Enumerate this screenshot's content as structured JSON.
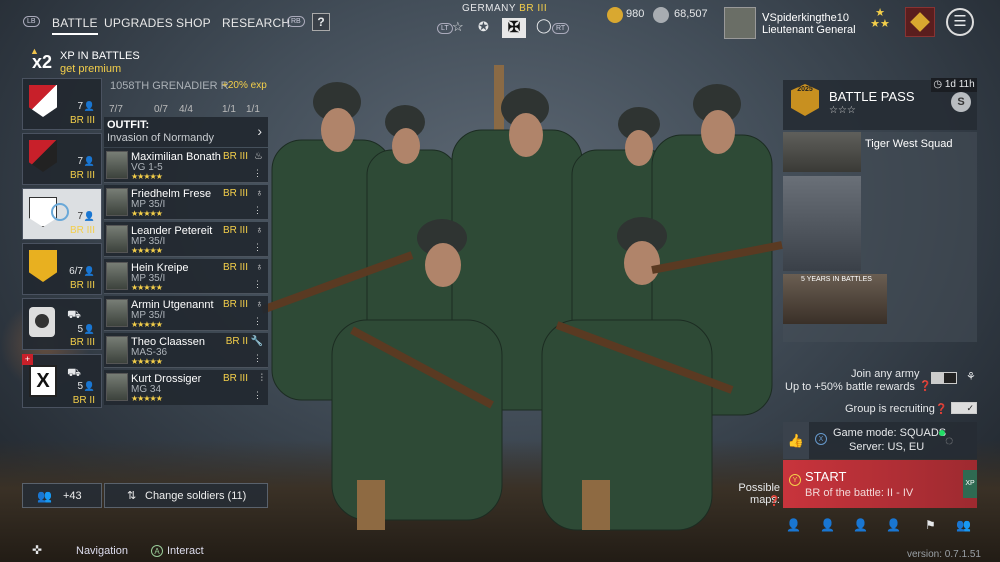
{
  "nav": {
    "lb": "LB",
    "rb": "RB",
    "tabs": [
      "BATTLE",
      "UPGRADES",
      "SHOP",
      "RESEARCH"
    ],
    "help": "?"
  },
  "army": {
    "nation": "GERMANY",
    "br": "BR III",
    "lt": "LT",
    "rt": "RT"
  },
  "currency": {
    "gold": "980",
    "silver": "68,507"
  },
  "user": {
    "name": "ⅤSpiderkingthe10",
    "rank": "Lieutenant General"
  },
  "xp": {
    "mult": "x2",
    "label": "XP IN BATTLES",
    "sub": "get premium"
  },
  "squad_header": {
    "name": "1058TH GRENADIER R",
    "bonus": "+20% exp",
    "counts": [
      "7/7",
      "0/7",
      "4/4",
      "1/1",
      "1/1"
    ]
  },
  "outfit": {
    "label": "OUTFIT:",
    "value": "Invasion of Normandy"
  },
  "squads": [
    {
      "count": "7",
      "br": "BR III",
      "color": "#c8202a"
    },
    {
      "count": "7",
      "br": "BR III",
      "color": "#c8202a"
    },
    {
      "count": "7",
      "br": "BR III",
      "color": "#ffffff"
    },
    {
      "count": "6/7",
      "br": "BR III",
      "color": "#e8b020"
    },
    {
      "count": "5",
      "br": "BR III",
      "color": "#444444"
    },
    {
      "count": "5",
      "br": "BR II",
      "color": "#222222"
    }
  ],
  "soldiers": [
    {
      "name": "Maximilian Bonath",
      "weapon": "VG 1-5",
      "br": "BR III",
      "stars": "★★★★★",
      "icon": "♨"
    },
    {
      "name": "Friedhelm Frese",
      "weapon": "MP 35/I",
      "br": "BR III",
      "stars": "★★★★★",
      "icon": "♁"
    },
    {
      "name": "Leander Petereit",
      "weapon": "MP 35/I",
      "br": "BR III",
      "stars": "★★★★★",
      "icon": "♁"
    },
    {
      "name": "Hein Kreipe",
      "weapon": "MP 35/I",
      "br": "BR III",
      "stars": "★★★★★",
      "icon": "♁"
    },
    {
      "name": "Armin Utgenannt",
      "weapon": "MP 35/I",
      "br": "BR III",
      "stars": "★★★★★",
      "icon": "♁"
    },
    {
      "name": "Theo Claassen",
      "weapon": "MAS-36",
      "br": "BR II",
      "stars": "★★★★★",
      "icon": "🔧"
    },
    {
      "name": "Kurt Drossiger",
      "weapon": "MG 34",
      "br": "BR III",
      "stars": "★★★★★",
      "icon": "⫶"
    }
  ],
  "bottom_left": {
    "friends": "+43",
    "change": "Change soldiers (11)",
    "navigation": "Navigation",
    "interact": "Interact"
  },
  "battle_pass": {
    "title": "BATTLE PASS",
    "timer": "1d 11h",
    "stars": "☆☆☆",
    "level": "S",
    "year": "2025",
    "items": [
      "Tiger West Squad",
      "",
      "5 YEARS IN BATTLES"
    ]
  },
  "join": {
    "line1": "Join any army",
    "line2": "Up to +50% battle rewards",
    "recruit": "Group is recruiting"
  },
  "mode": {
    "line1": "Game mode: SQUADS",
    "line2": "Server: US, EU"
  },
  "start": {
    "label": "START",
    "sub": "BR of the battle: II - IV",
    "xp": "XP"
  },
  "maps": {
    "label": "Possible maps:"
  },
  "version": "version: 0.7.1.51",
  "colors": {
    "accent": "#f4cf4a",
    "start": "#c8343c",
    "panel": "#262c34"
  }
}
